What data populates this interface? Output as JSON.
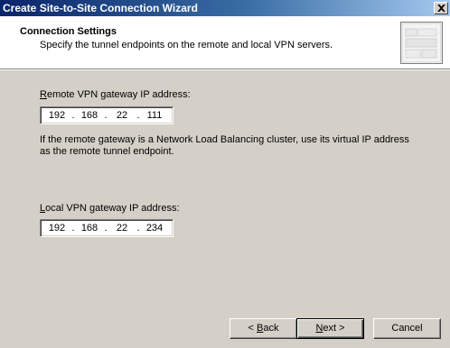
{
  "window": {
    "title": "Create Site-to-Site Connection Wizard"
  },
  "header": {
    "title": "Connection Settings",
    "subtitle": "Specify the tunnel endpoints on the remote and local VPN servers."
  },
  "remote": {
    "label_accel": "R",
    "label_rest": "emote VPN gateway IP address:",
    "octets": [
      "192",
      "168",
      "22",
      "111"
    ]
  },
  "help_text": "If the remote gateway is a Network Load Balancing cluster, use its virtual IP address as the remote tunnel endpoint.",
  "local": {
    "label_accel": "L",
    "label_rest": "ocal VPN gateway IP address:",
    "octets": [
      "192",
      "168",
      "22",
      "234"
    ]
  },
  "buttons": {
    "back_prefix": "< ",
    "back_accel": "B",
    "back_rest": "ack",
    "next_accel": "N",
    "next_rest": "ext >",
    "cancel": "Cancel"
  },
  "colors": {
    "title_start": "#0a246a",
    "title_end": "#a6caf0",
    "face": "#d4d0c8"
  }
}
